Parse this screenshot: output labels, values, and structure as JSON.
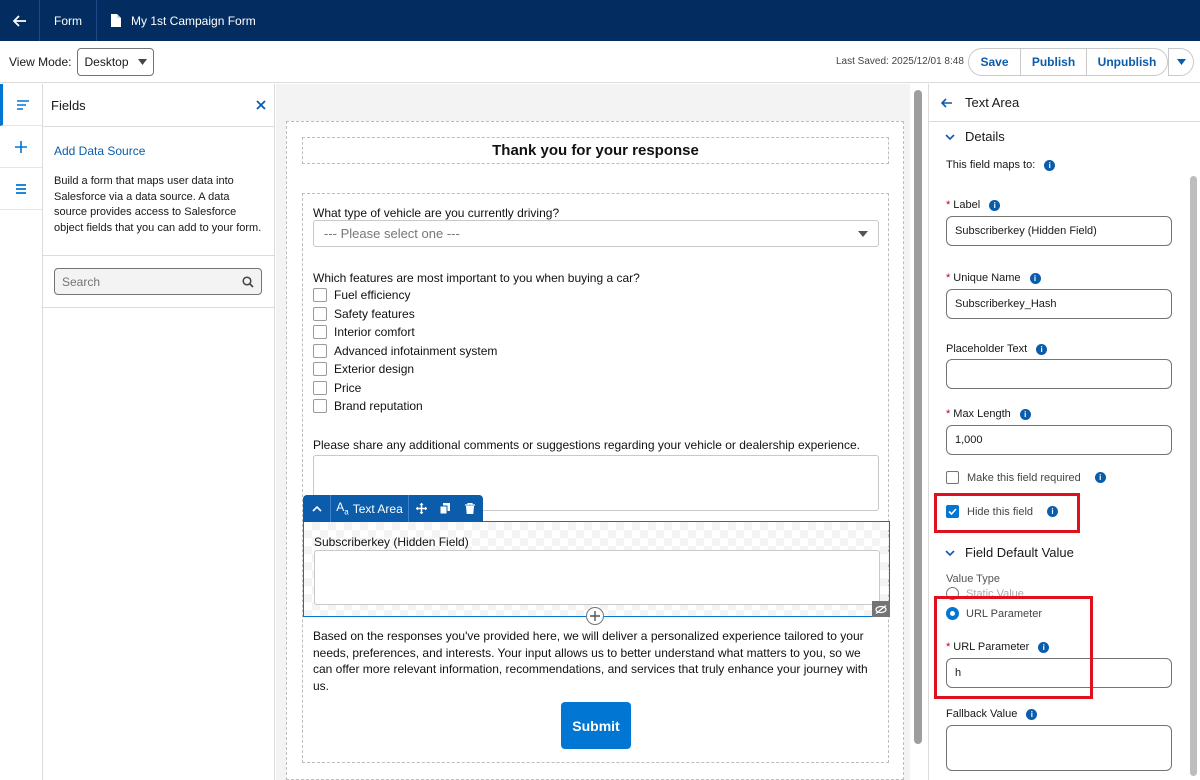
{
  "topbar": {
    "crumb": "Form",
    "title": "My 1st Campaign Form"
  },
  "toolbar": {
    "view_mode_label": "View Mode:",
    "view_mode_value": "Desktop",
    "last_saved": "Last Saved: 2025/12/01 8:48",
    "save_label": "Save",
    "publish_label": "Publish",
    "unpublish_label": "Unpublish"
  },
  "fields_panel": {
    "title": "Fields",
    "add_data_source": "Add Data Source",
    "description": "Build a form that maps user data into Salesforce via a data source. A data source provides access to Salesforce object fields that you can add to your form.",
    "search_placeholder": "Search"
  },
  "form": {
    "heading": "Thank you for your response",
    "q1": "What type of vehicle are you currently driving?",
    "q1_placeholder": "--- Please select one ---",
    "q2": "Which features are most important to you when buying a car?",
    "features": [
      "Fuel efficiency",
      "Safety features",
      "Interior comfort",
      "Advanced infotainment system",
      "Exterior design",
      "Price",
      "Brand reputation"
    ],
    "q3": "Please share any additional comments or suggestions regarding your vehicle or dealership experience.",
    "component_type": "Text Area",
    "selected_field_label": "Subscriberkey (Hidden Field)",
    "paragraph": "Based on the responses you've provided here, we will deliver a personalized experience tailored to your needs, preferences, and interests. Your input allows us to better understand what matters to you, so we can offer more relevant information, recommendations, and services that truly enhance your journey with us.",
    "submit_label": "Submit"
  },
  "properties": {
    "header": "Text Area",
    "details_title": "Details",
    "maps_to": "This field maps to:",
    "label_label": "Label",
    "label_value": "Subscriberkey (Hidden Field)",
    "unique_name_label": "Unique Name",
    "unique_name_value": "Subscriberkey_Hash",
    "placeholder_label": "Placeholder Text",
    "placeholder_value": "",
    "max_length_label": "Max Length",
    "max_length_value": "1,000",
    "required_label": "Make this field required",
    "required_checked": false,
    "hide_label": "Hide this field",
    "hide_checked": true,
    "default_title": "Field Default Value",
    "value_type_label": "Value Type",
    "static_value": "Static Value",
    "url_parameter_option": "URL Parameter",
    "url_parameter_label": "URL Parameter",
    "url_parameter_value": "h",
    "fallback_label": "Fallback Value",
    "fallback_value": ""
  },
  "colors": {
    "nav": "#032d60",
    "accent": "#0176d3",
    "highlight": "#e0101e"
  }
}
